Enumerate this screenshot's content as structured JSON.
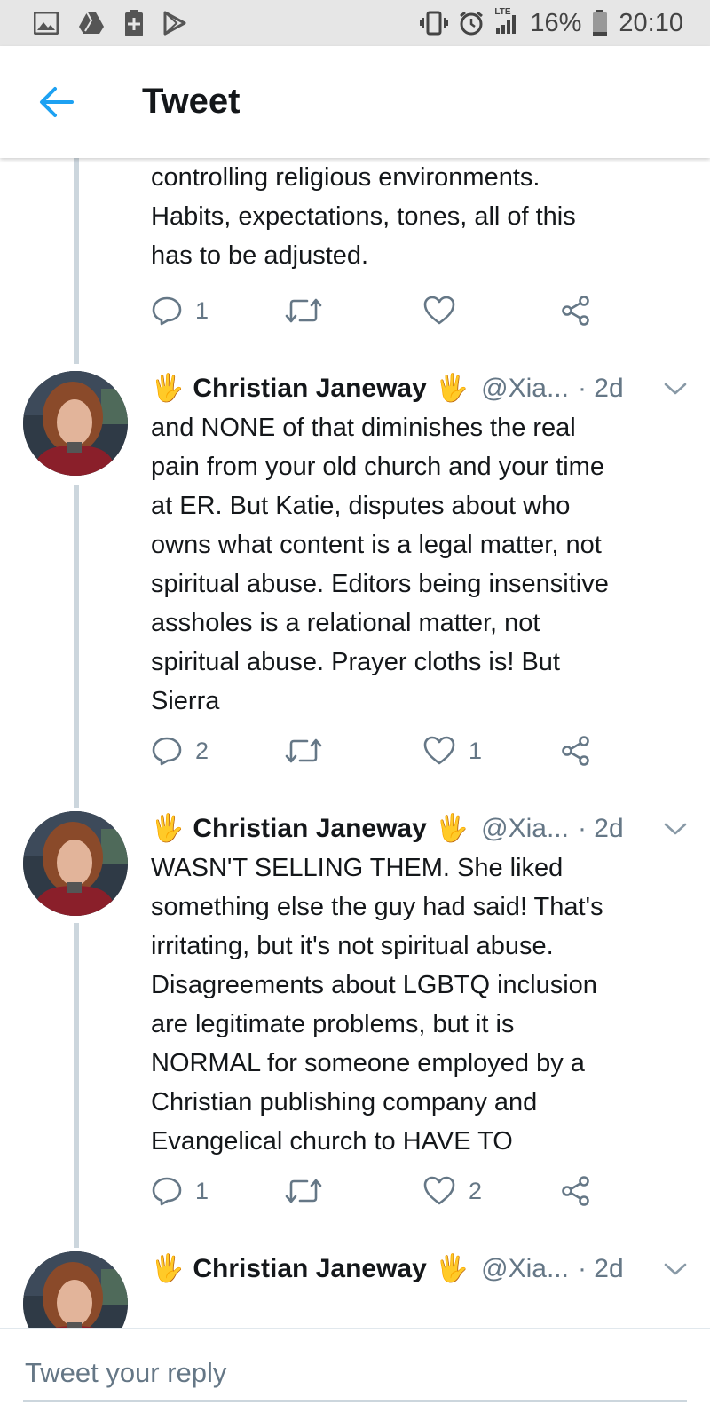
{
  "status_bar": {
    "network": "LTE",
    "battery": "16%",
    "time": "20:10"
  },
  "header": {
    "title": "Tweet"
  },
  "partial_tweet": {
    "lines": [
      "controlling religious environments.",
      "Habits, expectations, tones, all of this",
      "has to be adjusted."
    ],
    "reply_count": "1",
    "retweet_count": "",
    "like_count": ""
  },
  "tweets": [
    {
      "display_name": "Christian Janeway",
      "emoji": "🖐",
      "handle": "@Xia...",
      "time": "· 2d",
      "lines": [
        "and NONE of that diminishes the real",
        "pain from your old church and your time",
        "at ER. But Katie, disputes about who",
        "owns what content is a legal matter, not",
        "spiritual abuse. Editors being insensitive",
        "assholes is a relational matter, not",
        "spiritual abuse. Prayer cloths is! But",
        "Sierra"
      ],
      "reply_count": "2",
      "retweet_count": "",
      "like_count": "1"
    },
    {
      "display_name": "Christian Janeway",
      "emoji": "🖐",
      "handle": "@Xia...",
      "time": "· 2d",
      "lines": [
        "WASN'T SELLING THEM. She liked",
        "something else the guy had said! That's",
        "irritating, but it's not spiritual abuse.",
        "Disagreements about LGBTQ inclusion",
        "are legitimate problems, but it is",
        "NORMAL for someone employed by a",
        "Christian publishing company and",
        "Evangelical church to HAVE TO"
      ],
      "reply_count": "1",
      "retweet_count": "",
      "like_count": "2"
    },
    {
      "display_name": "Christian Janeway",
      "emoji": "🖐",
      "handle": "@Xia...",
      "time": "· 2d"
    }
  ],
  "reply_bar": {
    "placeholder": "Tweet your reply"
  },
  "colors": {
    "accent": "#1da1f2",
    "text_primary": "#14171a",
    "text_secondary": "#657786",
    "thread_line": "#ccd6dd"
  },
  "icons": {
    "reply": "reply-icon",
    "retweet": "retweet-icon",
    "like": "heart-icon",
    "share": "share-icon",
    "back": "back-arrow-icon",
    "more": "chevron-down-icon"
  }
}
